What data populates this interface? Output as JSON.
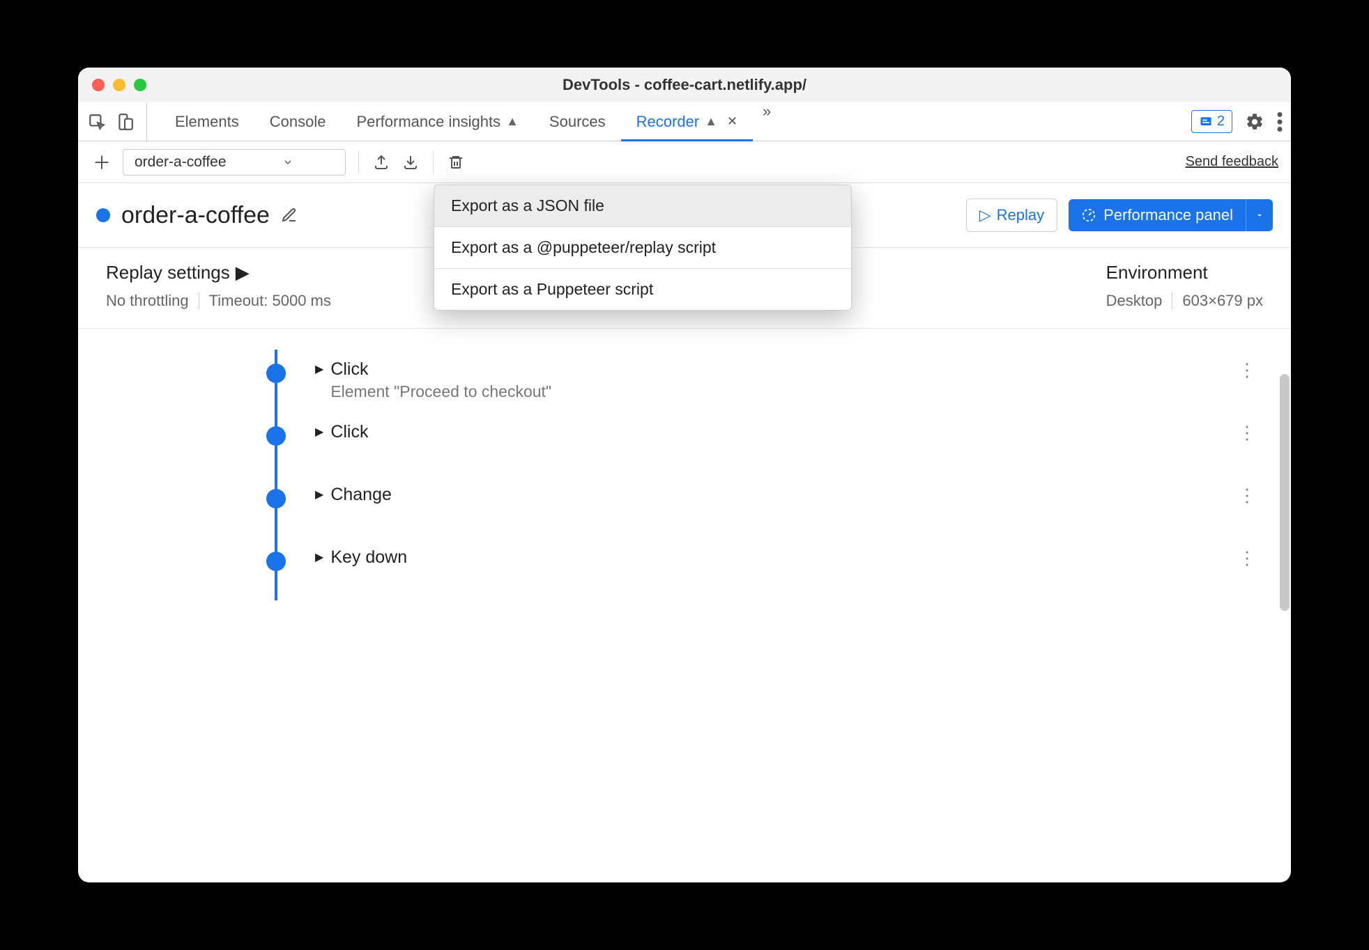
{
  "window": {
    "title": "DevTools - coffee-cart.netlify.app/"
  },
  "tabs": {
    "items": [
      {
        "label": "Elements"
      },
      {
        "label": "Console"
      },
      {
        "label": "Performance insights"
      },
      {
        "label": "Sources"
      },
      {
        "label": "Recorder"
      }
    ],
    "issues_count": "2"
  },
  "recorder_toolbar": {
    "selected_recording": "order-a-coffee",
    "feedback_link": "Send feedback"
  },
  "export_menu": {
    "item1": "Export as a JSON file",
    "item2": "Export as a @puppeteer/replay script",
    "item3": "Export as a Puppeteer script"
  },
  "header": {
    "recording_name": "order-a-coffee",
    "replay_label": "Replay",
    "perf_label": "Performance panel"
  },
  "settings": {
    "replay_title": "Replay settings",
    "throttling": "No throttling",
    "timeout": "Timeout: 5000 ms",
    "env_title": "Environment",
    "env_device": "Desktop",
    "env_dims": "603×679 px"
  },
  "steps": [
    {
      "title": "Click",
      "detail": "Element \"Proceed to checkout\""
    },
    {
      "title": "Click",
      "detail": ""
    },
    {
      "title": "Change",
      "detail": ""
    },
    {
      "title": "Key down",
      "detail": ""
    }
  ]
}
